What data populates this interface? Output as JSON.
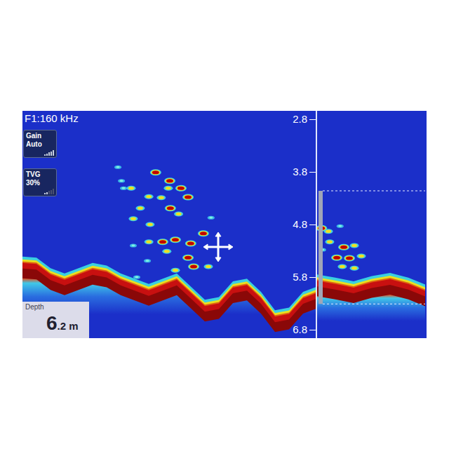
{
  "sonar": {
    "frequency": "F1:160 kHz",
    "gain": {
      "label": "Gain",
      "value": "Auto",
      "level": 1.0
    },
    "tvg": {
      "label": "TVG",
      "value": "30%",
      "level": 0.3
    },
    "depth": {
      "label": "Depth",
      "value_major": "6",
      "value_minor": ".2 m"
    },
    "scale": [
      "2.8",
      "3.8",
      "4.8",
      "5.8",
      "6.8"
    ],
    "scale_depths": [
      2.8,
      3.8,
      4.8,
      5.8,
      6.8
    ],
    "bottom": [
      5.53,
      5.55,
      5.75,
      5.85,
      5.75,
      5.65,
      5.7,
      5.85,
      5.95,
      6.05,
      5.95,
      5.85,
      6.1,
      6.35,
      6.3,
      6.0,
      5.95,
      6.2,
      6.55,
      6.5,
      6.2,
      6.1
    ],
    "targets": [
      [
        45.2,
        3.81,
        0.9
      ],
      [
        50,
        3.97,
        0.9
      ],
      [
        49.5,
        4.11,
        0.6
      ],
      [
        53.8,
        4.11,
        0.9
      ],
      [
        56.2,
        4.28,
        0.9
      ],
      [
        47.1,
        4.29,
        0.6
      ],
      [
        32.4,
        3.71,
        0.3
      ],
      [
        33.6,
        3.97,
        0.3
      ],
      [
        36.9,
        4.11,
        0.6
      ],
      [
        42.9,
        4.27,
        0.6
      ],
      [
        50.2,
        4.49,
        0.9
      ],
      [
        40,
        4.49,
        0.6
      ],
      [
        37.6,
        4.69,
        0.6
      ],
      [
        43.3,
        4.8,
        0.6
      ],
      [
        53,
        4.6,
        0.6
      ],
      [
        61.4,
        4.97,
        0.9
      ],
      [
        47.6,
        5.13,
        0.9
      ],
      [
        51.9,
        5.09,
        0.9
      ],
      [
        57.1,
        5.16,
        0.9
      ],
      [
        42.9,
        5.13,
        0.6
      ],
      [
        37.6,
        5.2,
        0.3
      ],
      [
        49,
        5.31,
        0.6
      ],
      [
        56.2,
        5.43,
        0.9
      ],
      [
        58.1,
        5.6,
        0.9
      ],
      [
        42.4,
        5.49,
        0.3
      ],
      [
        51.9,
        5.67,
        0.6
      ],
      [
        63.1,
        5.6,
        0.6
      ],
      [
        38.8,
        5.8,
        0.3
      ],
      [
        64,
        4.67,
        0.3
      ],
      [
        34.3,
        4.11,
        0.3
      ]
    ],
    "cursor": [
      66.4,
      5.23
    ]
  },
  "zoom": {
    "window_top": 4.16,
    "window_bottom": 6.31,
    "bottom": [
      5.87,
      5.93,
      6.0,
      5.9,
      5.84,
      5.93,
      6.07
    ],
    "targets": [
      [
        4,
        4.87,
        0.9
      ],
      [
        10.3,
        4.93,
        0.6
      ],
      [
        21,
        4.83,
        0.3
      ],
      [
        11.5,
        5.13,
        0.6
      ],
      [
        24.4,
        5.23,
        0.9
      ],
      [
        34,
        5.2,
        0.6
      ],
      [
        18,
        5.43,
        0.9
      ],
      [
        29.5,
        5.44,
        0.9
      ],
      [
        40.4,
        5.4,
        0.6
      ],
      [
        23,
        5.6,
        0.6
      ],
      [
        34,
        5.63,
        0.6
      ],
      [
        5,
        5.28,
        0.3
      ]
    ]
  }
}
